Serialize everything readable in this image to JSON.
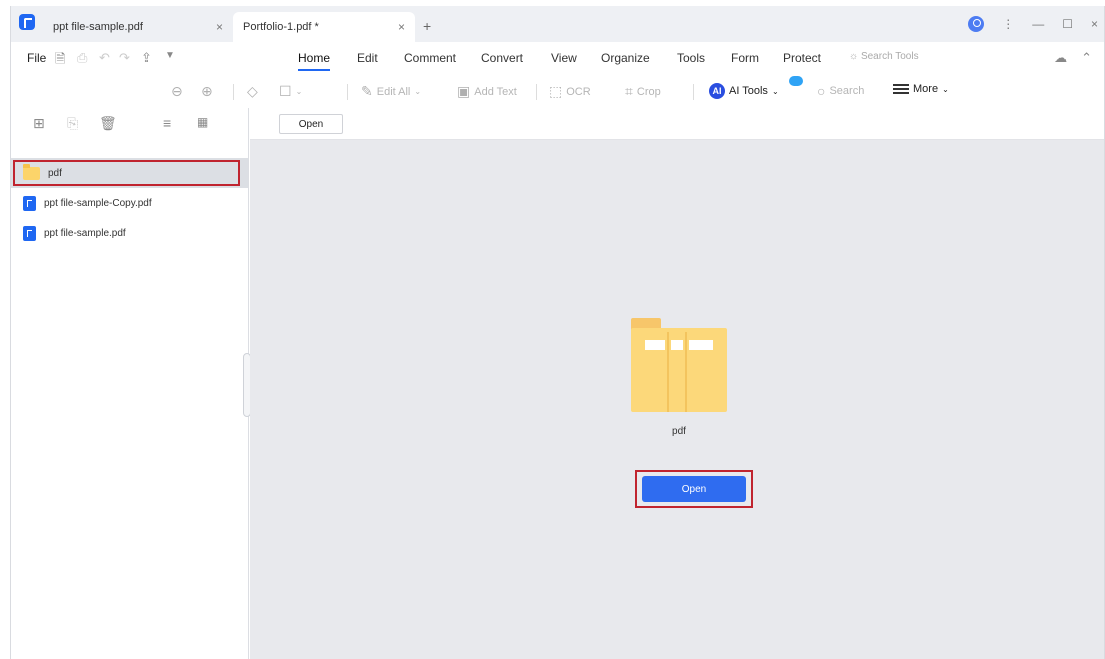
{
  "tabs": [
    {
      "label": "ppt file-sample.pdf",
      "close": "×"
    },
    {
      "label": "Portfolio-1.pdf *",
      "close": "×"
    }
  ],
  "tab_add": "+",
  "window_controls": {
    "more": "⋮",
    "minimize": "—",
    "maximize": "☐",
    "close": "×"
  },
  "menubar": {
    "file": "File",
    "items": [
      "Home",
      "Edit",
      "Comment",
      "Convert",
      "View",
      "Organize",
      "Tools",
      "Form",
      "Protect"
    ],
    "active": "Home",
    "search_tools": "Search Tools"
  },
  "toolbar": {
    "edit_all": "Edit All",
    "add_text": "Add Text",
    "ocr": "OCR",
    "crop": "Crop",
    "ai_tools": "AI Tools",
    "ai_badge": "AI",
    "search": "Search",
    "more": "More"
  },
  "sidebar": {
    "items": [
      {
        "name": "pdf",
        "type": "folder"
      },
      {
        "name": "ppt file-sample-Copy.pdf",
        "type": "pdf"
      },
      {
        "name": "ppt file-sample.pdf",
        "type": "pdf"
      }
    ]
  },
  "content": {
    "open_small": "Open",
    "folder_name": "pdf",
    "open_button": "Open"
  },
  "colors": {
    "accent": "#2f6cf0",
    "highlight": "#c0242f",
    "folder": "#fcd87a"
  }
}
